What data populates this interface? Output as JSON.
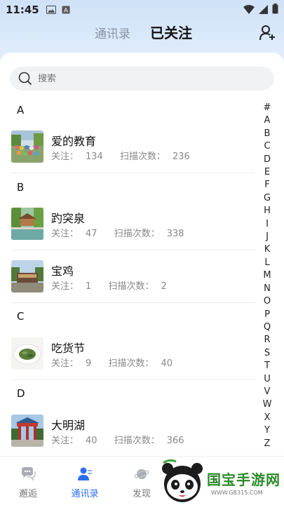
{
  "status_bar": {
    "time": "11:45",
    "icons": [
      "image-icon",
      "a-notification-icon",
      "wifi-icon",
      "cellular-icon",
      "battery-icon"
    ]
  },
  "header": {
    "tabs": [
      {
        "label": "通讯录",
        "active": false
      },
      {
        "label": "已关注",
        "active": true
      }
    ],
    "add_user_icon": "add-user-icon"
  },
  "search": {
    "placeholder": "搜索"
  },
  "sections": [
    {
      "letter": "A",
      "items": [
        {
          "name": "爱的教育",
          "follow_label": "关注：",
          "follow": "134",
          "scan_label": "扫描次数：",
          "scans": "236"
        }
      ]
    },
    {
      "letter": "B",
      "items": [
        {
          "name": "趵突泉",
          "follow_label": "关注：",
          "follow": "47",
          "scan_label": "扫描次数：",
          "scans": "338"
        },
        {
          "name": "宝鸡",
          "follow_label": "关注：",
          "follow": "1",
          "scan_label": "扫描次数：",
          "scans": "2"
        }
      ]
    },
    {
      "letter": "C",
      "items": [
        {
          "name": "吃货节",
          "follow_label": "关注：",
          "follow": "9",
          "scan_label": "扫描次数：",
          "scans": "40"
        }
      ]
    },
    {
      "letter": "D",
      "items": [
        {
          "name": "大明湖",
          "follow_label": "关注：",
          "follow": "40",
          "scan_label": "扫描次数：",
          "scans": "366"
        }
      ]
    }
  ],
  "index_letters": [
    "#",
    "A",
    "B",
    "C",
    "D",
    "E",
    "F",
    "G",
    "H",
    "I",
    "J",
    "K",
    "L",
    "M",
    "N",
    "O",
    "P",
    "Q",
    "R",
    "S",
    "T",
    "U",
    "V",
    "W",
    "X",
    "Y",
    "Z"
  ],
  "bottom_nav": [
    {
      "label": "邂逅",
      "icon": "chat-bubbles-icon",
      "active": false
    },
    {
      "label": "通讯录",
      "icon": "contacts-icon",
      "active": true
    },
    {
      "label": "发现",
      "icon": "planet-icon",
      "active": false
    }
  ],
  "watermark": {
    "text": "国宝手游网",
    "url": "WWW.GB315.COM"
  },
  "colors": {
    "accent": "#2d6cf6",
    "inactive_tab": "#8a94a6",
    "meta_text": "#888888",
    "watermark_green": "#2a8a2a"
  }
}
